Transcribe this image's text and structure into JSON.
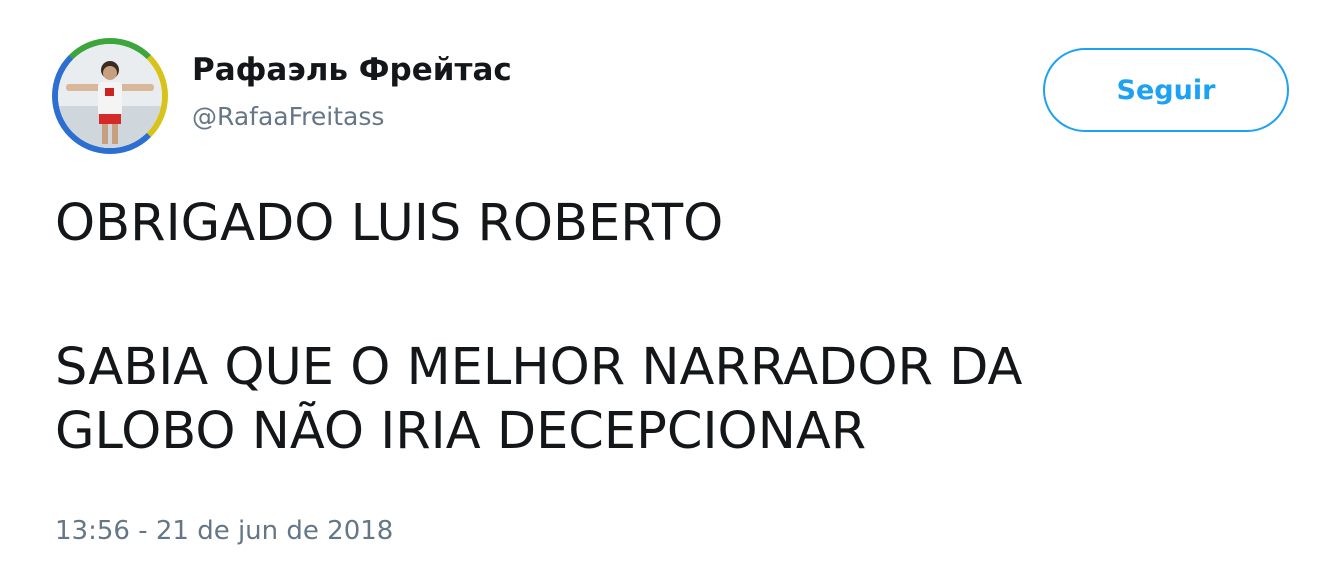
{
  "user": {
    "display_name": "Рафаэль Фрейтас",
    "handle": "@RafaaFreitass",
    "avatar_icon": "user-photo-avatar"
  },
  "actions": {
    "follow_label": "Seguir"
  },
  "tweet": {
    "lines": [
      "OBRIGADO LUIS ROBERTO",
      "SABIA QUE O MELHOR NARRADOR DA",
      "GLOBO NÃO IRIA DECEPCIONAR"
    ],
    "timestamp": "13:56 - 21 de jun de 2018"
  },
  "colors": {
    "accent": "#1da1f2",
    "text": "#14171a",
    "secondary_text": "#657786",
    "background": "#ffffff"
  }
}
